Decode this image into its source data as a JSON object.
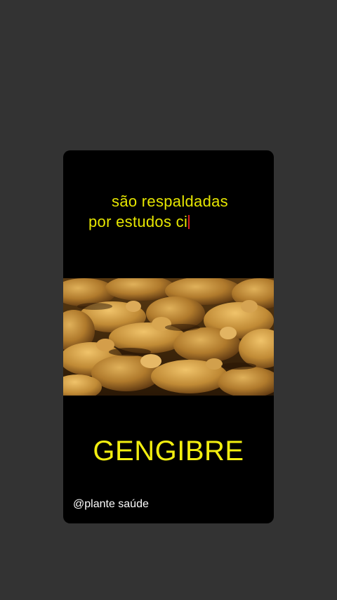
{
  "story": {
    "caption_line1": "são respaldadas",
    "caption_line2": "por estudos ci",
    "title": "GENGIBRE",
    "handle": "@plante saúde",
    "image_subject": "ginger-roots-photo"
  },
  "colors": {
    "background": "#333333",
    "card": "#000000",
    "caption_text": "#e6e600",
    "title_text": "#f2ee10",
    "handle_text": "#ffffff",
    "cursor": "#d62020"
  }
}
